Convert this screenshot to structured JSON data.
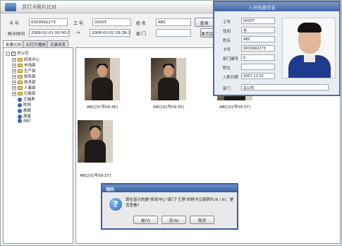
{
  "main": {
    "title": "员打卡照片比对",
    "labels": {
      "card_no": "卡 号",
      "emp_no": "工 号",
      "name": "姓 名",
      "swipe_time": "刷卡时间",
      "to": "->",
      "dept": "部 门"
    },
    "values": {
      "card_no": "0003992273",
      "emp_no": "0000T",
      "name": "ABC",
      "time_from": "2008-02-01 00:00:00",
      "time_to": "2008-02-02 09:38:20",
      "dept": ""
    },
    "buttons": {
      "query": "查询",
      "show": "显示比对"
    },
    "tabs": [
      "批量比较",
      "幻灯片播放",
      "记录浏览"
    ]
  },
  "tree": [
    {
      "label": "总公司",
      "kind": "root"
    },
    {
      "label": "研发中心",
      "kind": "dept"
    },
    {
      "label": "市场部",
      "kind": "dept"
    },
    {
      "label": "生产部",
      "kind": "dept"
    },
    {
      "label": "财务部",
      "kind": "dept"
    },
    {
      "label": "技术部",
      "kind": "dept"
    },
    {
      "label": "人事部",
      "kind": "dept"
    },
    {
      "label": "行政部",
      "kind": "dept"
    },
    {
      "label": "王福贵",
      "kind": "person"
    },
    {
      "label": "陈旭",
      "kind": "person"
    },
    {
      "label": "杨顺",
      "kind": "person"
    },
    {
      "label": "周星",
      "kind": "person"
    },
    {
      "label": "ABC",
      "kind": "person"
    }
  ],
  "photos": [
    {
      "caption": "ABC[01号09:36]"
    },
    {
      "caption": "ABC[01号09:35]"
    },
    {
      "caption": "ABC[01号09:37]"
    },
    {
      "caption": "ABC[01号09:37]"
    }
  ],
  "info": {
    "title": "人员档案信息",
    "rows": [
      {
        "label": "工号",
        "value": "0000T"
      },
      {
        "label": "性别",
        "value": "男"
      },
      {
        "label": "姓名",
        "value": "ABC"
      },
      {
        "label": "卡号",
        "value": "0003992273"
      },
      {
        "label": "部门编号",
        "value": "0"
      },
      {
        "label": "职位",
        "value": ""
      },
      {
        "label": "入职日期",
        "value": "2007-12-01"
      },
      {
        "label": "部门",
        "value": "总公司"
      }
    ]
  },
  "dialog": {
    "title": "询问",
    "message": "现在显示的是\"研发中心\"部门\"王旭\"的刷卡记录照片(6 / 6)，是否查看?",
    "buttons": {
      "yes": "是(Y)",
      "no": "否(N)",
      "cancel": "取消"
    }
  }
}
